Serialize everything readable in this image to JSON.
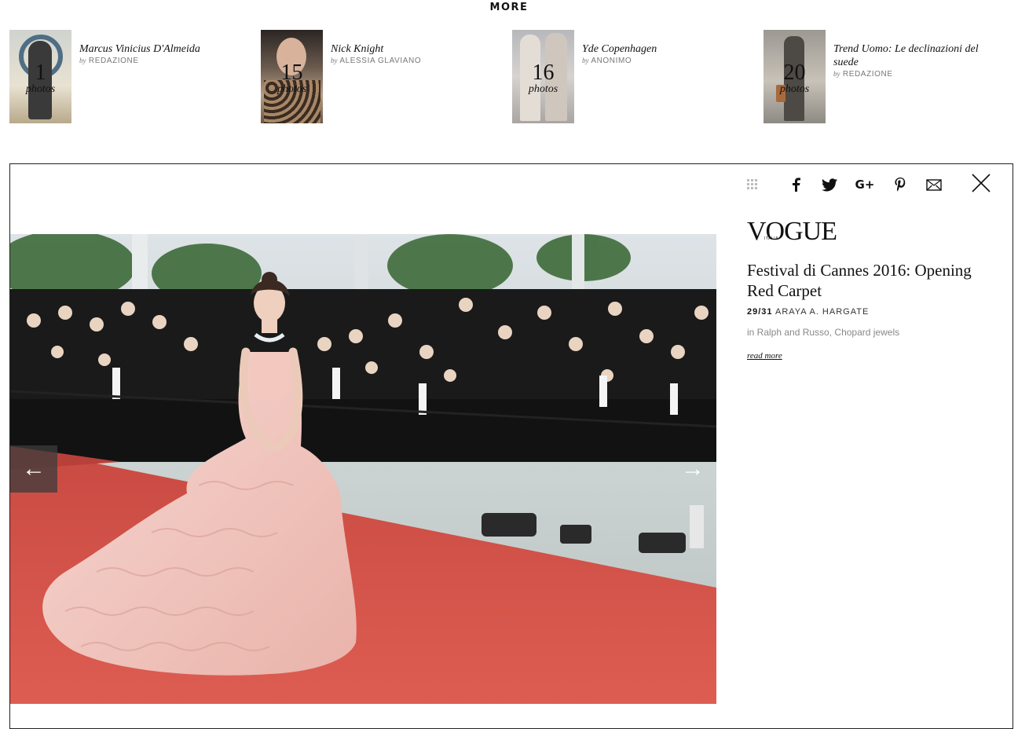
{
  "more_heading": "MORE",
  "galleries": [
    {
      "title": "Marcus Vinicius D'Almeida",
      "by": "by",
      "author": "REDAZIONE",
      "count": "1",
      "unit": "photos"
    },
    {
      "title": "Nick Knight",
      "by": "by",
      "author": "ALESSIA GLAVIANO",
      "count": "15",
      "unit": "photos"
    },
    {
      "title": "Yde Copenhagen",
      "by": "by",
      "author": "ANONIMO",
      "count": "16",
      "unit": "photos"
    },
    {
      "title": "Trend Uomo: Le declinazioni del suede",
      "by": "by",
      "author": "REDAZIONE",
      "count": "20",
      "unit": "photos"
    }
  ],
  "viewer": {
    "logo": "VOGUE",
    "logo_small": "ITALIA",
    "title": "Festival di Cannes 2016: Opening Red Carpet",
    "counter": "29/31",
    "subject": "ARAYA A. HARGATE",
    "caption": "in Ralph and Russo, Chopard jewels",
    "read_more": "read more",
    "prev_arrow": "←",
    "next_arrow": "→",
    "share": [
      "facebook",
      "twitter",
      "google-plus",
      "pinterest",
      "email"
    ]
  },
  "colors": {
    "red_carpet": "#d8564c",
    "gown": "#f2c6bf",
    "tuxedo": "#151515",
    "sky": "#d9dee0"
  }
}
